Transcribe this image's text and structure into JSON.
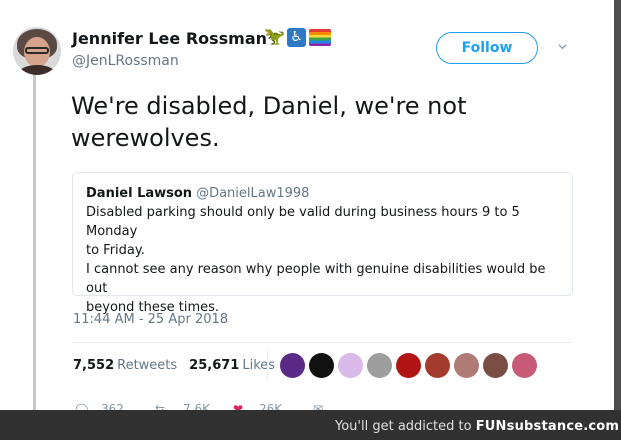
{
  "tweet": {
    "author": {
      "name": "Jennifer Lee Rossman",
      "handle": "@JenLRossman",
      "name_emojis": [
        "t-rex-emoji",
        "wheelchair-emoji",
        "rainbow-flag-emoji"
      ]
    },
    "follow_label": "Follow",
    "text": "We're disabled, Daniel, we're not werewolves.",
    "quoted": {
      "name": "Daniel Lawson",
      "handle": "@DanielLaw1998",
      "lines": [
        "Disabled parking should only be valid during business hours 9 to 5 Monday",
        "to Friday.",
        "I cannot see any reason why people with genuine disabilities would be out",
        "beyond these times."
      ]
    },
    "timestamp": "11:44 AM - 25 Apr 2018",
    "stats": {
      "retweets_count": "7,552",
      "retweets_label": "Retweets",
      "likes_count": "25,671",
      "likes_label": "Likes"
    },
    "liker_avatar_colors": [
      "#5b2a86",
      "#111111",
      "#d9b8ea",
      "#9e9e9e",
      "#b01414",
      "#a33b2e",
      "#b07b74",
      "#7a4e44",
      "#c95a77"
    ],
    "actions": {
      "reply_count": "362",
      "retweet_count": "7.6K",
      "like_count": "26K"
    }
  },
  "watermark": {
    "prefix": "You'll get addicted to",
    "brand": "FUNsubstance.com"
  },
  "colors": {
    "accent": "#1da1f2",
    "text": "#14171a",
    "secondary_text": "#657786",
    "banner": "#313131"
  }
}
